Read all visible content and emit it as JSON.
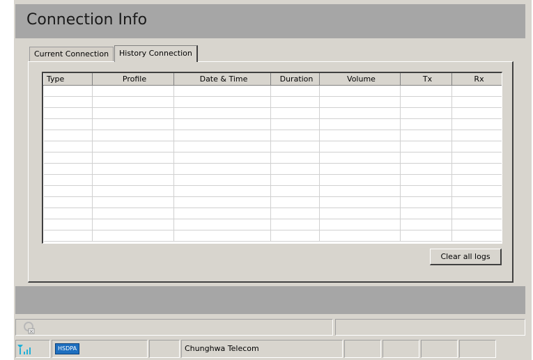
{
  "page_title": "Connection Info",
  "tabs": [
    {
      "label": "Current Connection",
      "active": false
    },
    {
      "label": "History Connection",
      "active": true
    }
  ],
  "table": {
    "columns": [
      "Type",
      "Profile",
      "Date & Time",
      "Duration",
      "Volume",
      "Tx",
      "Rx"
    ],
    "empty_row_count": 14
  },
  "clear_button_label": "Clear all logs",
  "status": {
    "network_type": "HSDPA",
    "operator": "Chunghwa Telecom",
    "signal_icon": "signal-bars-icon",
    "disconnected_icon": "disconnect-icon"
  },
  "colors": {
    "title_band": "#a6a6a6",
    "panel": "#d8d5ce",
    "hsdpa": "#1e6fbf",
    "signal": "#22b0d8"
  }
}
